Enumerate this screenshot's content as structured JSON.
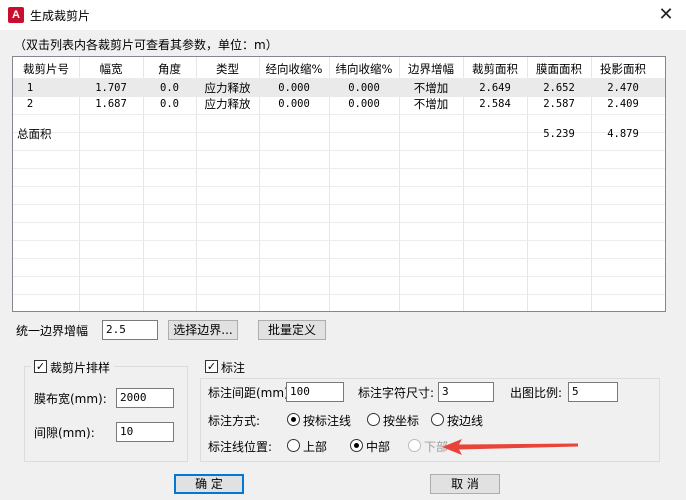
{
  "window": {
    "title": "生成裁剪片",
    "close_glyph": "✕"
  },
  "hint": "（双击列表内各裁剪片可查看其参数，单位：m）",
  "table": {
    "headers": [
      "裁剪片号",
      "幅宽",
      "角度",
      "类型",
      "经向收缩%",
      "纬向收缩%",
      "边界增幅",
      "裁剪面积",
      "膜面面积",
      "投影面积"
    ],
    "rows": [
      [
        "1",
        "1.707",
        "0.0",
        "应力释放",
        "0.000",
        "0.000",
        "不增加",
        "2.649",
        "2.652",
        "2.470"
      ],
      [
        "2",
        "1.687",
        "0.0",
        "应力释放",
        "0.000",
        "0.000",
        "不增加",
        "2.584",
        "2.587",
        "2.409"
      ]
    ],
    "total": {
      "label": "总面积",
      "membrane_area": "5.239",
      "projected_area": "4.879"
    }
  },
  "boundary": {
    "label": "统一边界增幅",
    "value": "2.5",
    "select_button": "选择边界...",
    "batch_button": "批量定义"
  },
  "layout_group": {
    "title": "裁剪片排样",
    "checked": true,
    "width_label": "膜布宽(mm):",
    "width_value": "2000",
    "gap_label": "间隙(mm):",
    "gap_value": "10"
  },
  "annotation_group": {
    "title": "标注",
    "checked": true,
    "spacing_label": "标注间距(mm):",
    "spacing_value": "100",
    "char_size_label": "标注字符尺寸:",
    "char_size_value": "3",
    "scale_label": "出图比例:",
    "scale_value": "5",
    "method_label": "标注方式:",
    "methods": [
      "按标注线",
      "按坐标",
      "按边线"
    ],
    "method_selected": "按标注线",
    "position_label": "标注线位置:",
    "positions": [
      "上部",
      "中部",
      "下部"
    ],
    "position_selected": "中部",
    "position_disabled": "下部"
  },
  "footer": {
    "ok": "确 定",
    "cancel": "取 消"
  },
  "colors": {
    "accent": "#0078d7",
    "arrow": "#e8443a",
    "app_icon": "#c8102e"
  },
  "icons": {
    "app": "autocad-app-icon",
    "close": "close-icon",
    "arrow": "red-arrow-annotation"
  }
}
